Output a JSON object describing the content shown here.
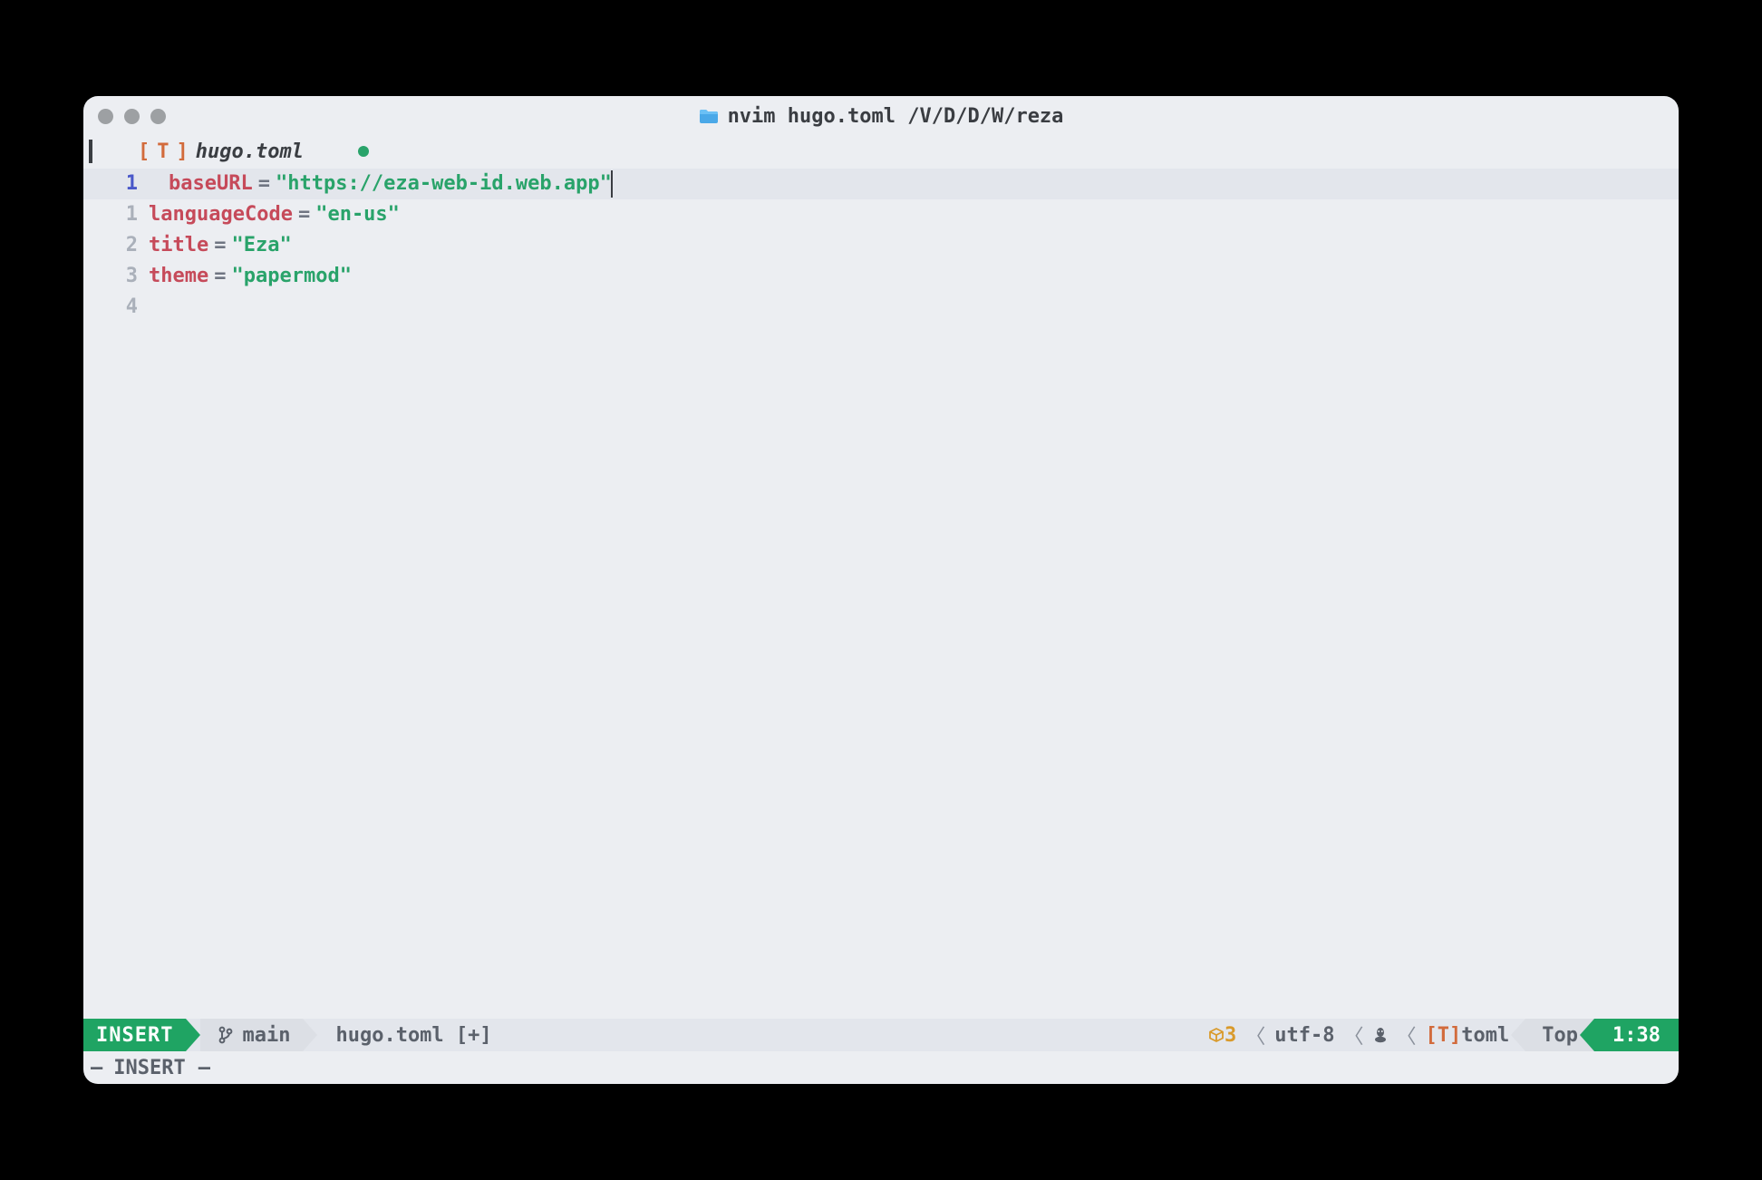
{
  "window": {
    "title": "nvim hugo.toml /V/D/D/W/reza"
  },
  "tab": {
    "type_marker": "T",
    "filename": "hugo.toml",
    "modified": true
  },
  "editor": {
    "current_line_abs": "1",
    "lines": [
      {
        "rel": "1",
        "indent": true,
        "key": "baseURL",
        "value": "\"https://eza-web-id.web.app\""
      },
      {
        "rel": "1",
        "indent": false,
        "key": "languageCode",
        "value": "\"en-us\""
      },
      {
        "rel": "2",
        "indent": false,
        "key": "title",
        "value": "\"Eza\""
      },
      {
        "rel": "3",
        "indent": false,
        "key": "theme",
        "value": "\"papermod\""
      },
      {
        "rel": "4",
        "indent": false,
        "key": "",
        "value": ""
      }
    ]
  },
  "status": {
    "mode": "INSERT",
    "branch": "main",
    "file": "hugo.toml [+]",
    "packages": "3",
    "encoding": "utf-8",
    "filetype_marker": "T",
    "filetype": "toml",
    "scroll": "Top",
    "position": "1:38"
  },
  "cmdline": {
    "mode": "INSERT"
  }
}
